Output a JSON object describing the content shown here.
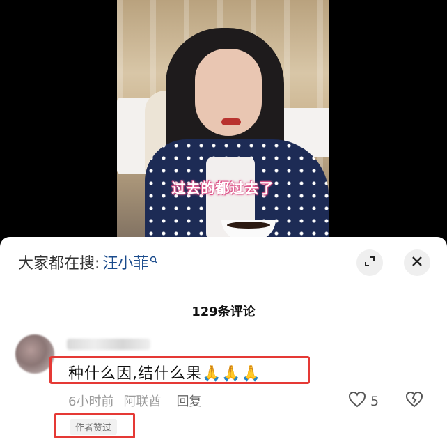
{
  "video": {
    "subtitle": "过去的都过去了"
  },
  "search": {
    "prefix": "大家都在搜:",
    "term": "汪小菲"
  },
  "comments_header": {
    "count_label": "129条评论"
  },
  "comment": {
    "text": "种什么因,结什么果🙏🙏🙏",
    "time": "6小时前",
    "location": "阿联酋",
    "reply_label": "回复",
    "like_count": "5",
    "author_badge": "作者赞过"
  },
  "colors": {
    "highlight_box": "#e53935",
    "search_term": "#1a4b8c",
    "subtitle_glow": "#e0588c"
  },
  "icons": {
    "search": "search-icon",
    "expand": "expand-icon",
    "close": "close-icon",
    "like": "heart-icon",
    "dislike": "broken-heart-icon"
  }
}
